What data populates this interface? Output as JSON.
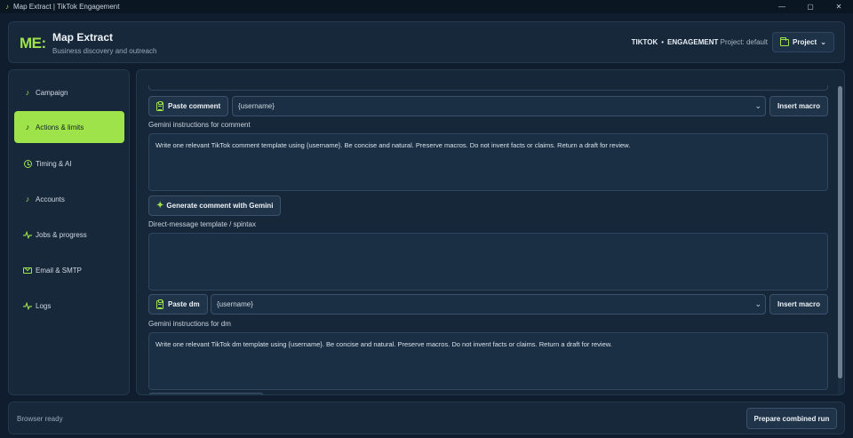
{
  "window": {
    "title": "Map Extract | TikTok Engagement",
    "controls": [
      "—",
      "▢",
      "✕"
    ]
  },
  "header": {
    "logo": "ME:",
    "title": "Map Extract",
    "subtitle": "Business discovery and outreach",
    "platform": "TIKTOK",
    "separator": "•",
    "mode": "ENGAGEMENT",
    "project_text": "Project: default",
    "project_button": "Project"
  },
  "sidebar": {
    "items": [
      {
        "label": "Campaign",
        "icon": "tiktok-icon",
        "active": false
      },
      {
        "label": "Actions & limits",
        "icon": "tiktok-icon",
        "active": true
      },
      {
        "label": "Timing & AI",
        "icon": "clock-icon",
        "active": false
      },
      {
        "label": "Accounts",
        "icon": "tiktok-icon",
        "active": false
      },
      {
        "label": "Jobs & progress",
        "icon": "pulse-icon",
        "active": false
      },
      {
        "label": "Email & SMTP",
        "icon": "mail-icon",
        "active": false
      },
      {
        "label": "Logs",
        "icon": "pulse-icon",
        "active": false
      }
    ]
  },
  "comment": {
    "paste_label": "Paste comment",
    "macro_value": "{username}",
    "insert_label": "Insert macro",
    "gemini_label": "Gemini instructions for comment",
    "gemini_text": "Write one relevant TikTok comment template using {username}. Be concise and natural. Preserve macros. Do not invent facts or claims. Return a draft for review.",
    "generate_label": "Generate comment with Gemini"
  },
  "dm": {
    "template_label": "Direct-message template / spintax",
    "template_value": "",
    "paste_label": "Paste dm",
    "macro_value": "{username}",
    "insert_label": "Insert macro",
    "gemini_label": "Gemini instructions for dm",
    "gemini_text": "Write one relevant TikTok dm template using {username}. Be concise and natural. Preserve macros. Do not invent facts or claims. Return a draft for review."
  },
  "footer": {
    "status": "Browser ready",
    "run_label": "Prepare combined run"
  }
}
